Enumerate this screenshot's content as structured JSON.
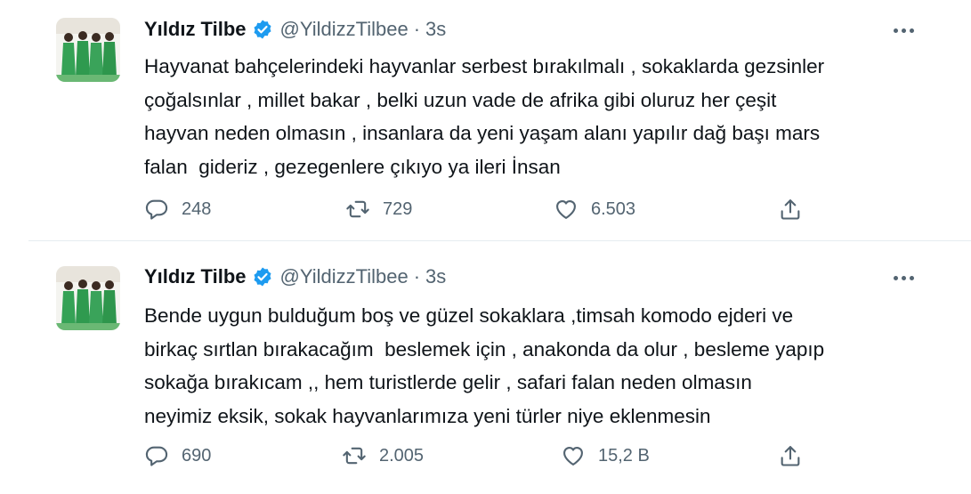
{
  "tweets": [
    {
      "name": "Yıldız Tilbe",
      "handle": "@YildizzTilbee",
      "separator": "·",
      "time": "3s",
      "text": "Hayvanat bahçelerindeki hayvanlar serbest bırakılmalı , sokaklarda gezsinler\nçoğalsınlar , millet bakar , belki uzun vade de afrika gibi oluruz her çeşit\nhayvan neden olmasın , insanlara da yeni yaşam alanı yapılır dağ başı mars\nfalan  gideriz , gezegenlere çıkıyo ya ileri İnsan",
      "replies": "248",
      "retweets": "729",
      "likes": "6.503"
    },
    {
      "name": "Yıldız Tilbe",
      "handle": "@YildizzTilbee",
      "separator": "·",
      "time": "3s",
      "text": "Bende uygun bulduğum boş ve güzel sokaklara ,timsah komodo ejderi ve\nbirkaç sırtlan bırakacağım  beslemek için , anakonda da olur , besleme yapıp\nsokağa bırakıcam ,, hem turistlerde gelir , safari falan neden olmasın\nneyimiz eksik, sokak hayvanlarımıza yeni türler niye eklenmesin",
      "replies": "690",
      "retweets": "2.005",
      "likes": "15,2 B"
    }
  ],
  "icons": {
    "verified": "verified-badge-icon",
    "more": "more-options-icon",
    "reply": "reply-icon",
    "retweet": "retweet-icon",
    "like": "heart-icon",
    "share": "share-icon"
  },
  "colors": {
    "text": "#0f1419",
    "secondary": "#536471",
    "verified": "#1d9bf0",
    "avatar_green": "#3aa35a"
  }
}
